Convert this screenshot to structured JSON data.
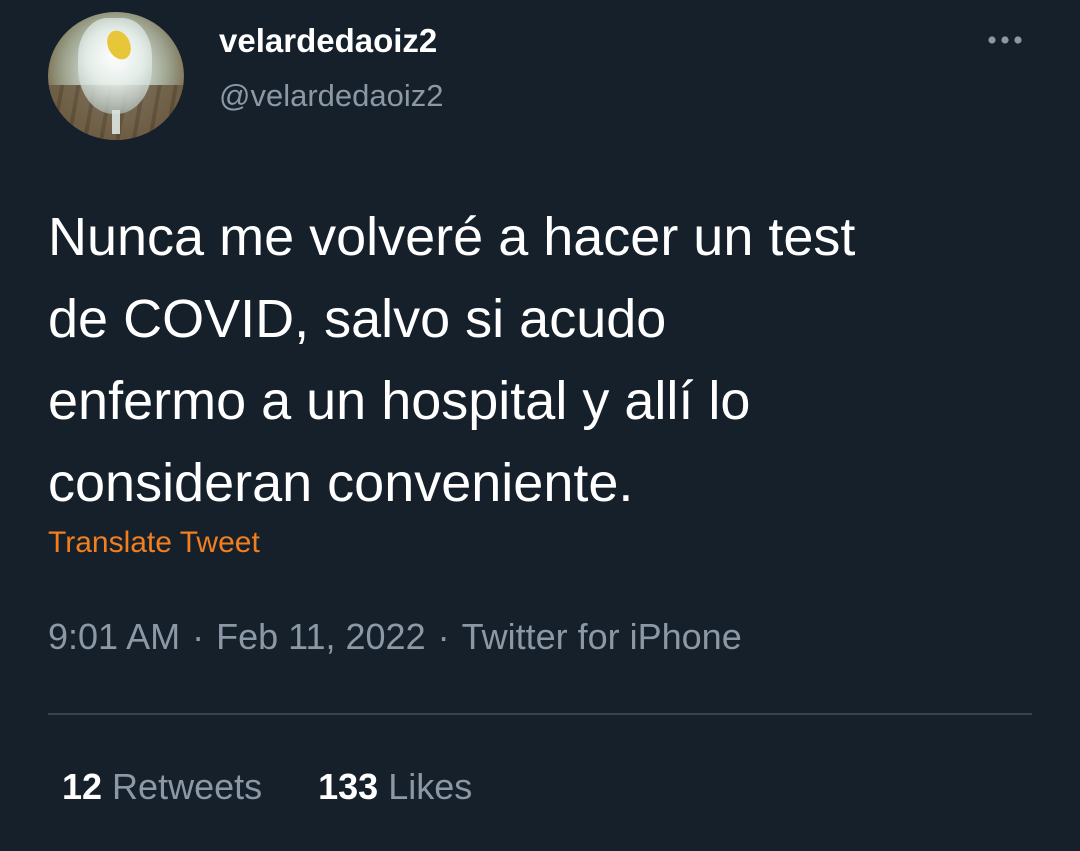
{
  "author": {
    "display_name": "velardedaoiz2",
    "handle": "@velardedaoiz2",
    "avatar_icon": "avatar-photo-glass-drink"
  },
  "more_icon": "more-horizontal-icon",
  "tweet": {
    "lines": [
      "Nunca me volveré a hacer un test",
      "de COVID, salvo si acudo",
      "enfermo a un hospital y allí lo",
      "consideran conveniente."
    ]
  },
  "translate_label": "Translate Tweet",
  "meta": {
    "time": "9:01 AM",
    "date": "Feb 11, 2022",
    "source": "Twitter for iPhone",
    "separator": "·"
  },
  "stats": {
    "retweets_count": "12",
    "retweets_label": "Retweets",
    "likes_count": "133",
    "likes_label": "Likes"
  },
  "colors": {
    "background": "#15202b",
    "text": "#ffffff",
    "secondary_text": "#8b98a5",
    "accent": "#f27e1f",
    "divider": "#38444d"
  }
}
